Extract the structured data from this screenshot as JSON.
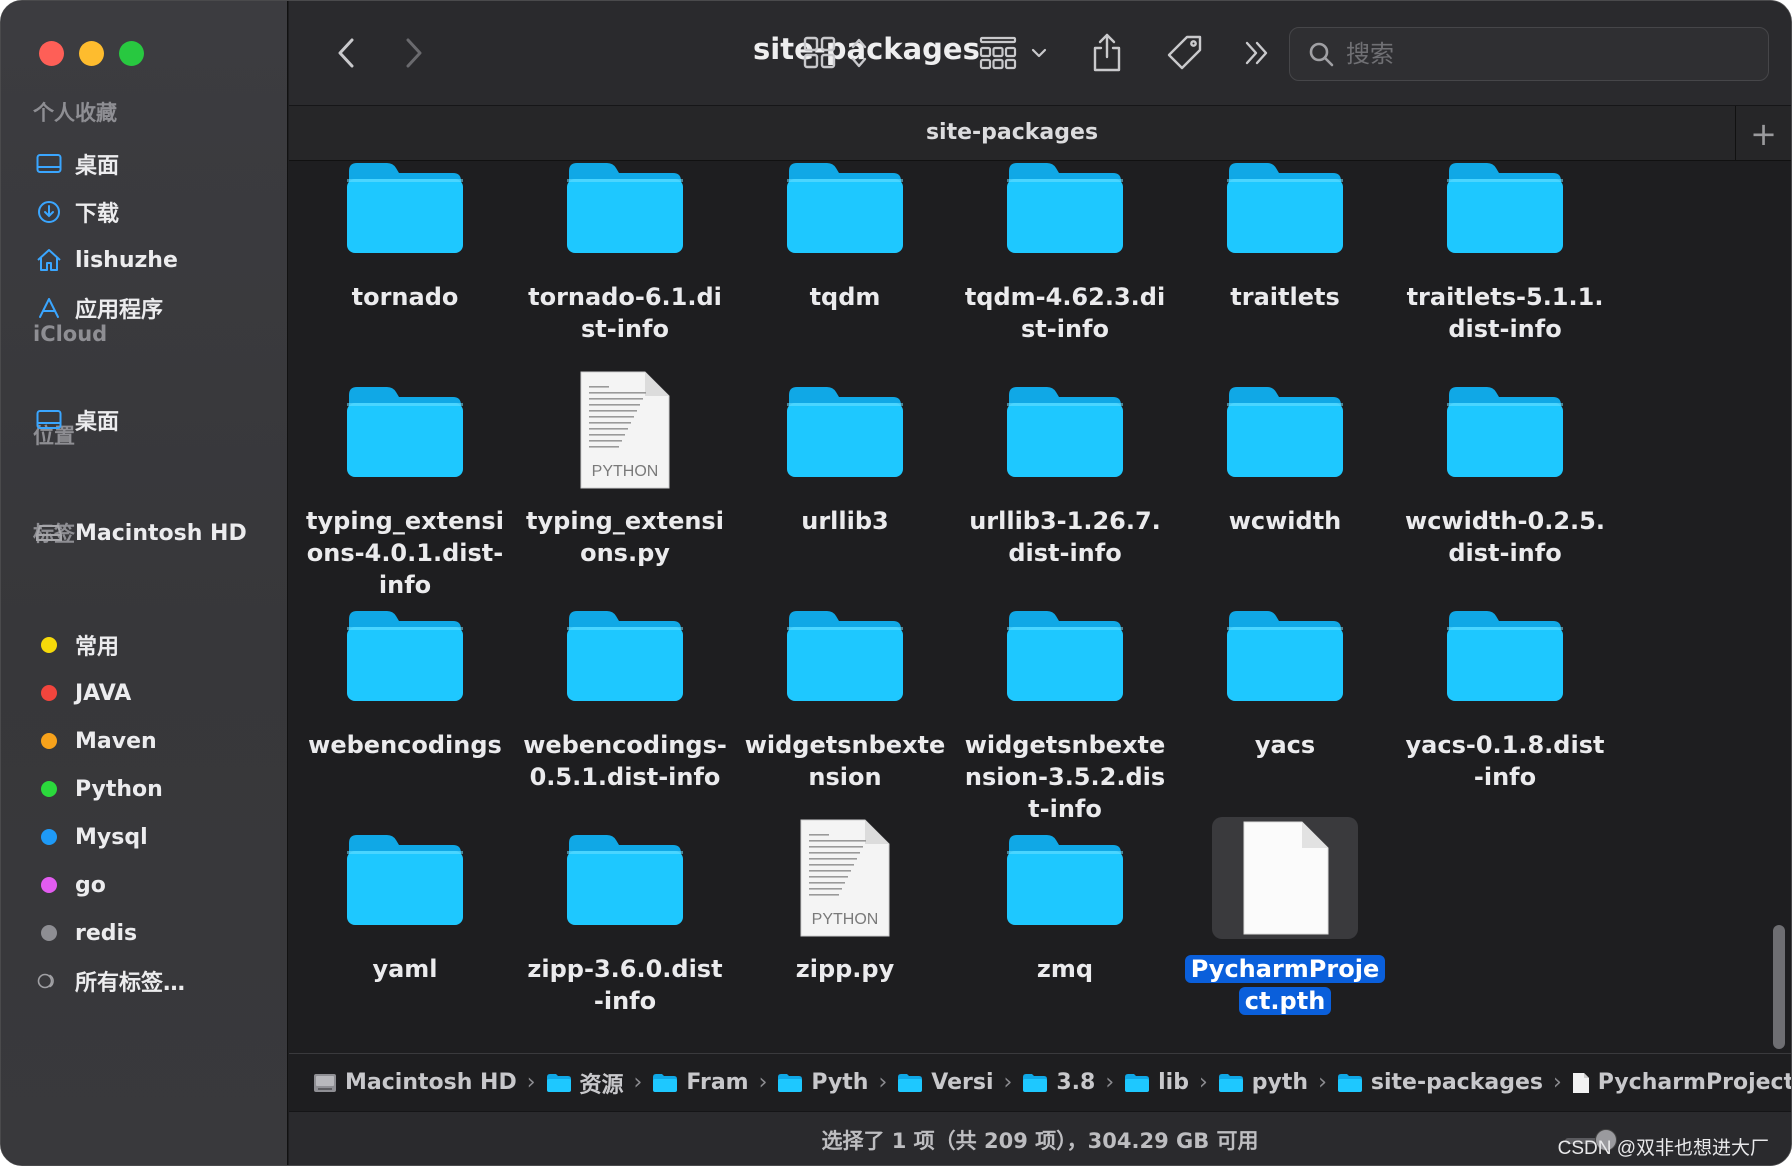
{
  "window": {
    "title": "site-packages"
  },
  "toolbar": {
    "title": "site-packages",
    "search_placeholder": "搜索"
  },
  "tab": {
    "label": "site-packages",
    "add_label": "+"
  },
  "sidebar": {
    "favorites_title": "个人收藏",
    "favorites": [
      {
        "label": "桌面",
        "icon": "desktop-icon"
      },
      {
        "label": "下载",
        "icon": "download-icon"
      },
      {
        "label": "lishuzhe",
        "icon": "home-icon"
      },
      {
        "label": "应用程序",
        "icon": "applications-icon"
      }
    ],
    "icloud_title": "iCloud",
    "icloud": [
      {
        "label": "桌面",
        "icon": "desktop-icon"
      }
    ],
    "locations_title": "位置",
    "locations": [
      {
        "label": "Macintosh HD",
        "icon": "disk-icon"
      }
    ],
    "tags_title": "标签",
    "tags": [
      {
        "label": "常用",
        "color": "#f5d90a"
      },
      {
        "label": "JAVA",
        "color": "#f2453d"
      },
      {
        "label": "Maven",
        "color": "#f7a21b"
      },
      {
        "label": "Python",
        "color": "#2bd93c"
      },
      {
        "label": "Mysql",
        "color": "#1e9af7"
      },
      {
        "label": "go",
        "color": "#e25cf0"
      },
      {
        "label": "redis",
        "color": "#8e8e93"
      }
    ],
    "all_tags_label": "所有标签…"
  },
  "files": [
    {
      "name": "tornado",
      "type": "folder"
    },
    {
      "name": "tornado-6.1.dist-info",
      "type": "folder"
    },
    {
      "name": "tqdm",
      "type": "folder"
    },
    {
      "name": "tqdm-4.62.3.dist-info",
      "type": "folder"
    },
    {
      "name": "traitlets",
      "type": "folder"
    },
    {
      "name": "traitlets-5.1.1.dist-info",
      "type": "folder"
    },
    {
      "name": "typing_extensions-4.0.1.dist-info",
      "type": "folder"
    },
    {
      "name": "typing_extensions.py",
      "type": "python",
      "badge": "PYTHON"
    },
    {
      "name": "urllib3",
      "type": "folder"
    },
    {
      "name": "urllib3-1.26.7.dist-info",
      "type": "folder"
    },
    {
      "name": "wcwidth",
      "type": "folder"
    },
    {
      "name": "wcwidth-0.2.5.dist-info",
      "type": "folder"
    },
    {
      "name": "webencodings",
      "type": "folder"
    },
    {
      "name": "webencodings-0.5.1.dist-info",
      "type": "folder"
    },
    {
      "name": "widgetsnbextension",
      "type": "folder"
    },
    {
      "name": "widgetsnbextension-3.5.2.dist-info",
      "type": "folder"
    },
    {
      "name": "yacs",
      "type": "folder"
    },
    {
      "name": "yacs-0.1.8.dist-info",
      "type": "folder"
    },
    {
      "name": "yaml",
      "type": "folder"
    },
    {
      "name": "zipp-3.6.0.dist-info",
      "type": "folder"
    },
    {
      "name": "zipp.py",
      "type": "python",
      "badge": "PYTHON"
    },
    {
      "name": "zmq",
      "type": "folder"
    },
    {
      "name": "PycharmProject.pth",
      "type": "file",
      "selected": true
    }
  ],
  "pathbar": [
    {
      "label": "Macintosh HD",
      "icon": "disk-icon"
    },
    {
      "label": "资源",
      "icon": "folder-icon"
    },
    {
      "label": "Fram",
      "icon": "folder-icon"
    },
    {
      "label": "Pyth",
      "icon": "folder-icon"
    },
    {
      "label": "Versi",
      "icon": "folder-icon"
    },
    {
      "label": "3.8",
      "icon": "folder-icon"
    },
    {
      "label": "lib",
      "icon": "folder-icon"
    },
    {
      "label": "pyth",
      "icon": "folder-icon"
    },
    {
      "label": "site-packages",
      "icon": "folder-icon"
    },
    {
      "label": "PycharmProject.pth",
      "icon": "file-icon"
    }
  ],
  "status": {
    "text": "选择了 1 项（共 209 项），304.29 GB 可用"
  },
  "watermark": "CSDN @双非也想进大厂",
  "colors": {
    "folder": "#1ec8ff",
    "folder_dark": "#10a8e6",
    "selection": "#0a5fdb"
  }
}
